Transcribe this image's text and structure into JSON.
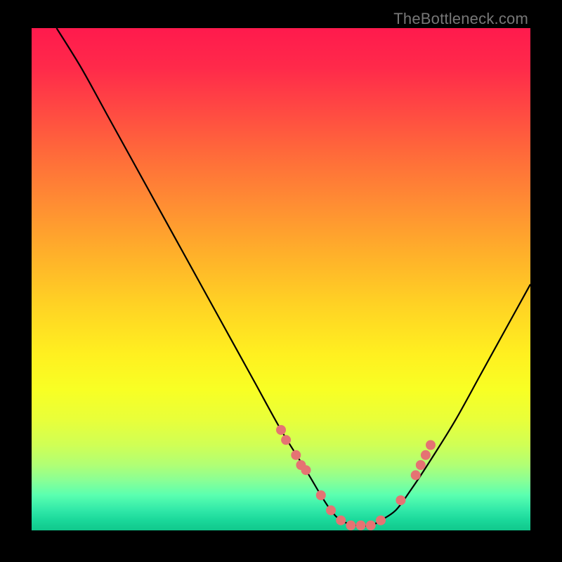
{
  "watermark": "TheBottleneck.com",
  "colors": {
    "background": "#000000",
    "curve": "#000000",
    "dot": "#e57373"
  },
  "chart_data": {
    "type": "line",
    "title": "",
    "xlabel": "",
    "ylabel": "",
    "xlim": [
      0,
      100
    ],
    "ylim": [
      0,
      100
    ],
    "grid": false,
    "legend": false,
    "series": [
      {
        "name": "bottleneck-curve",
        "x": [
          5,
          10,
          15,
          20,
          25,
          30,
          35,
          40,
          45,
          50,
          55,
          58,
          60,
          62,
          65,
          68,
          70,
          73,
          76,
          80,
          85,
          90,
          95,
          100
        ],
        "y": [
          100,
          92,
          83,
          74,
          65,
          56,
          47,
          38,
          29,
          20,
          12,
          7,
          4,
          2,
          1,
          1,
          2,
          4,
          8,
          14,
          22,
          31,
          40,
          49
        ]
      }
    ],
    "annotations": {
      "dots_x": [
        50,
        51,
        53,
        54,
        55,
        58,
        60,
        62,
        64,
        66,
        68,
        70,
        74,
        77,
        78,
        79,
        80
      ],
      "dots_y": [
        20,
        18,
        15,
        13,
        12,
        7,
        4,
        2,
        1,
        1,
        1,
        2,
        6,
        11,
        13,
        15,
        17
      ]
    }
  }
}
